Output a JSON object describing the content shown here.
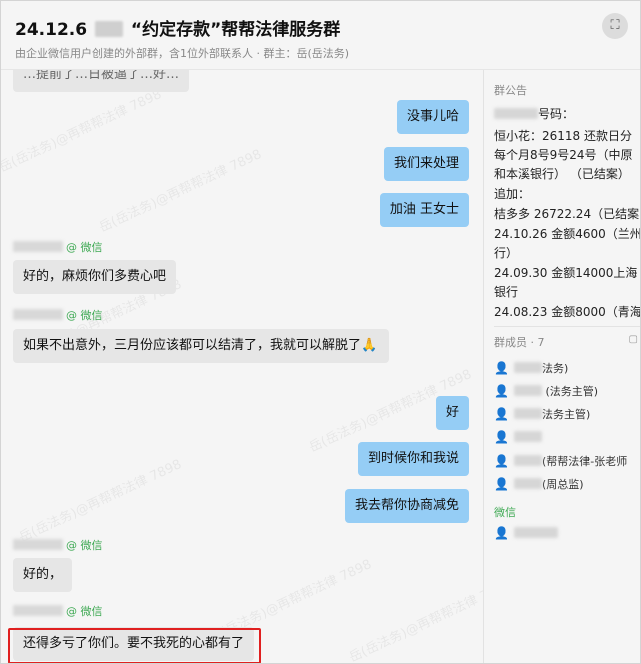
{
  "header": {
    "title_prefix": "24.12.6",
    "title_suffix": "“约定存款”帮帮法律服务群",
    "subtitle": "由企业微信用户创建的外部群，含1位外部联系人 · 群主：岳(岳法务)"
  },
  "watermark": "岳(岳法务)@再帮帮法律 7898",
  "messages": [
    {
      "type": "in",
      "text": "…提前了…日被逼了…好…",
      "partial": true
    },
    {
      "type": "out",
      "text": "没事儿哈"
    },
    {
      "type": "out",
      "text": "我们来处理"
    },
    {
      "type": "out",
      "text": "加油 王女士"
    },
    {
      "type": "sender",
      "suffix": "@ 微信"
    },
    {
      "type": "in",
      "text": "好的，麻烦你们多费心吧"
    },
    {
      "type": "sender",
      "suffix": "@ 微信"
    },
    {
      "type": "in",
      "text": "如果不出意外，三月份应该都可以结清了，我就可以解脱了🙏"
    },
    {
      "type": "out",
      "text": "好"
    },
    {
      "type": "out",
      "text": "到时候你和我说"
    },
    {
      "type": "out",
      "text": "我去帮你协商减免"
    },
    {
      "type": "sender",
      "suffix": "@ 微信"
    },
    {
      "type": "in",
      "text": "好的，"
    },
    {
      "type": "sender",
      "suffix": "@ 微信"
    },
    {
      "type": "in",
      "text": "还得多亏了你们。要不我死的心都有了"
    }
  ],
  "sidebar": {
    "notice_label": "群公告",
    "notice_lines": [
      "号码：",
      "恒小花：26118 还款日分",
      "每个月8号9号24号（中原",
      "和本溪银行） （已结案）",
      "追加：",
      "桔多多 26722.24（已结案",
      "24.10.26 金额4600（兰州",
      "行）",
      "24.09.30 金额14000上海",
      "银行",
      "24.08.23 金额8000（青海"
    ],
    "members_label": "群成员 · 7",
    "members": [
      {
        "name": "法务)",
        "icon": "person-blue-icon"
      },
      {
        "name": "(法务主管)",
        "icon": "person-blue-icon"
      },
      {
        "name": "法务主管)",
        "icon": "person-orange-icon"
      },
      {
        "name": "",
        "icon": "person-orange-icon"
      },
      {
        "name": "(帮帮法律-张老师",
        "icon": "person-blue-icon"
      },
      {
        "name": "(周总监)",
        "icon": "person-blue-icon"
      }
    ],
    "wechat_label": "微信",
    "wechat_members": [
      {
        "name": "",
        "icon": "person-blue-icon"
      }
    ]
  },
  "colors": {
    "out_bubble": "#95cdf5",
    "in_bubble": "#e6e6e6",
    "wechat_green": "#3fa954",
    "highlight": "#e02020"
  }
}
